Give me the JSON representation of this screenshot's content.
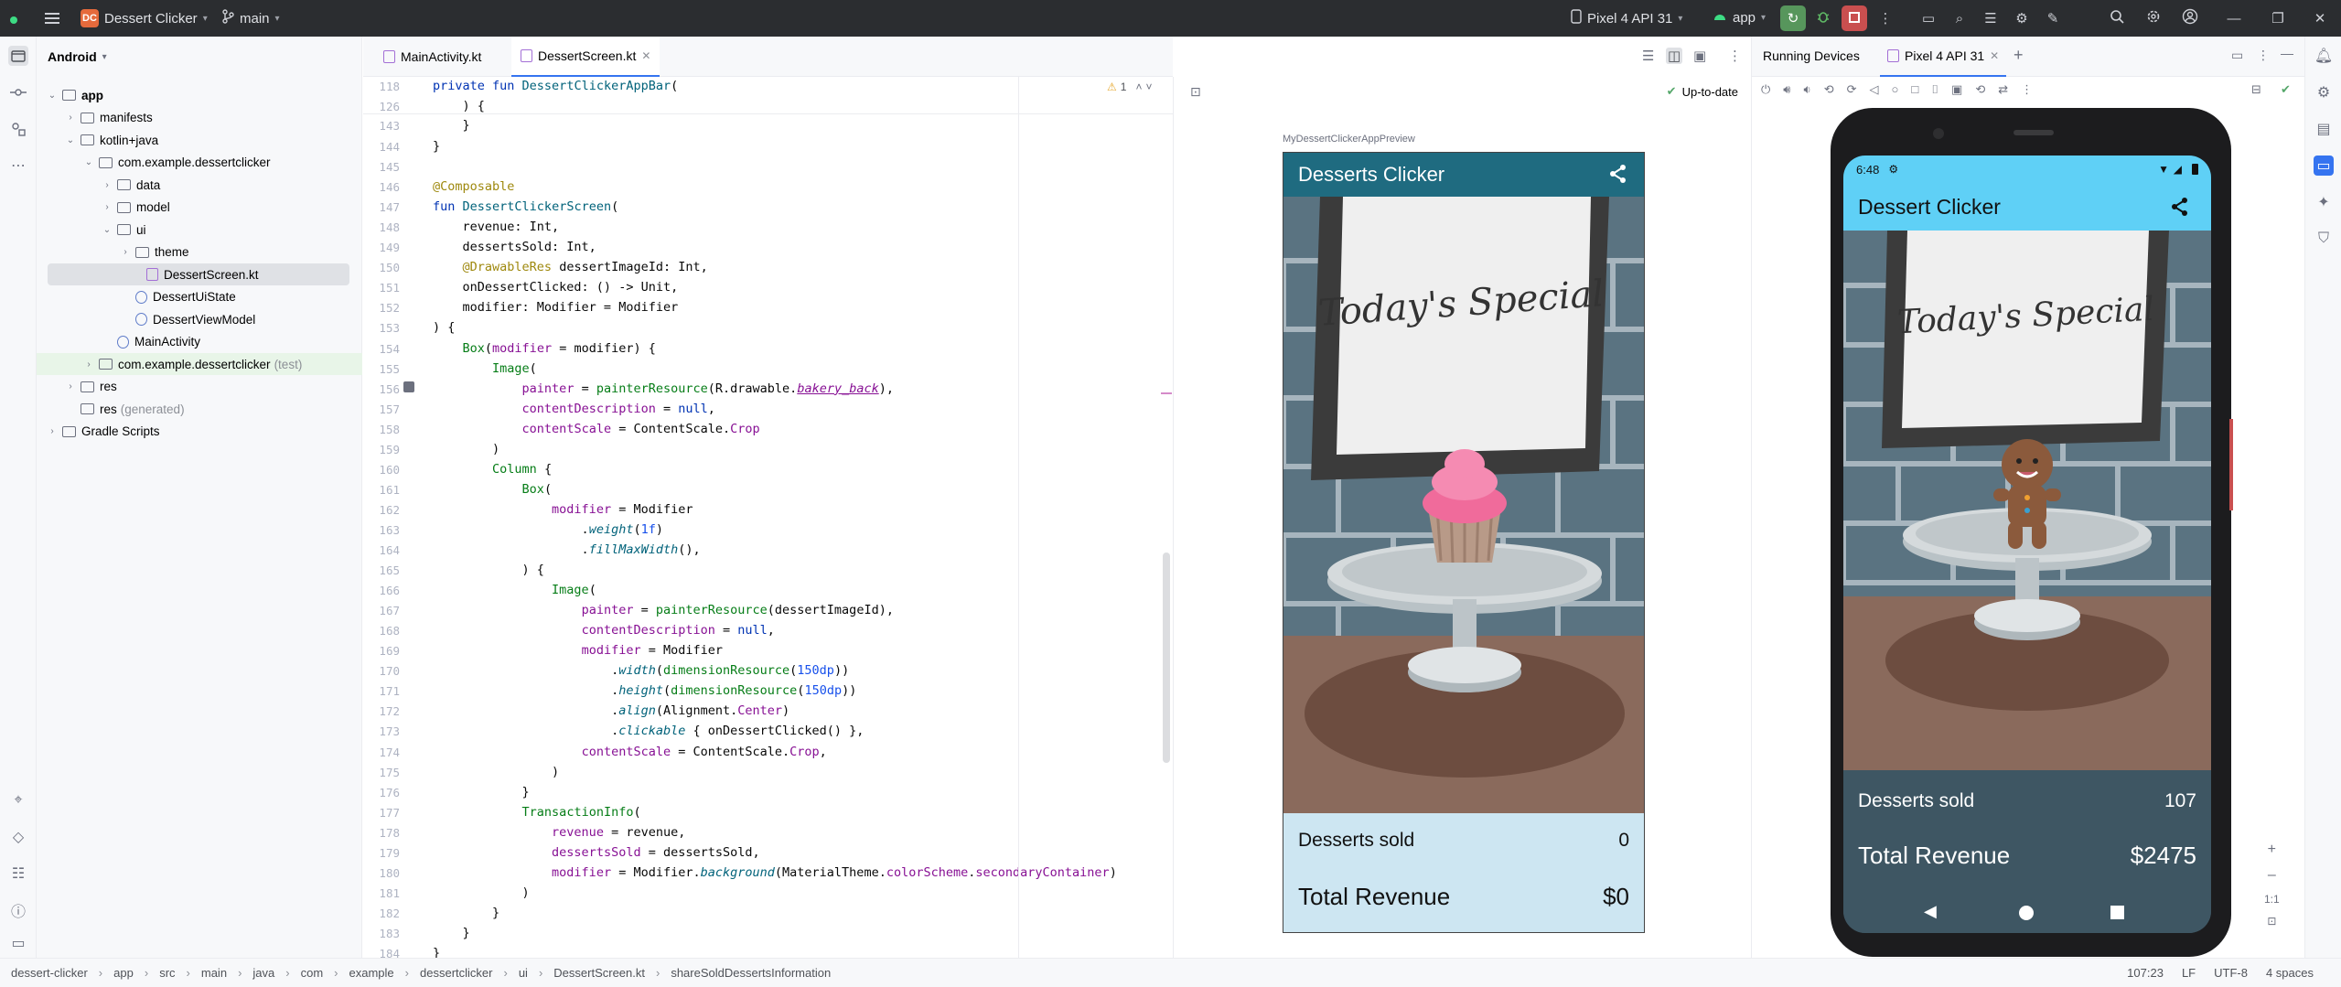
{
  "titlebar": {
    "project_badge": "DC",
    "project_name": "Dessert Clicker",
    "branch": "main",
    "device": "Pixel 4 API 31",
    "run_config": "app"
  },
  "project_panel": {
    "view": "Android",
    "items": [
      {
        "label": "app",
        "indent": 0,
        "icon": "folder",
        "chev": "down"
      },
      {
        "label": "manifests",
        "indent": 1,
        "icon": "folder",
        "chev": "right"
      },
      {
        "label": "kotlin+java",
        "indent": 1,
        "icon": "folder",
        "chev": "down"
      },
      {
        "label": "com.example.dessertclicker",
        "indent": 2,
        "icon": "folder",
        "chev": "down"
      },
      {
        "label": "data",
        "indent": 3,
        "icon": "folder",
        "chev": "right"
      },
      {
        "label": "model",
        "indent": 3,
        "icon": "folder",
        "chev": "right"
      },
      {
        "label": "ui",
        "indent": 3,
        "icon": "folder",
        "chev": "down"
      },
      {
        "label": "theme",
        "indent": 4,
        "icon": "folder",
        "chev": "right"
      },
      {
        "label": "DessertScreen.kt",
        "indent": 4,
        "icon": "kt",
        "chev": ""
      },
      {
        "label": "DessertUiState",
        "indent": 4,
        "icon": "file",
        "chev": ""
      },
      {
        "label": "DessertViewModel",
        "indent": 4,
        "icon": "file",
        "chev": ""
      },
      {
        "label": "MainActivity",
        "indent": 3,
        "icon": "file",
        "chev": ""
      },
      {
        "label": "com.example.dessertclicker",
        "suffix": "(test)",
        "indent": 2,
        "icon": "folder",
        "chev": "right"
      },
      {
        "label": "res",
        "indent": 1,
        "icon": "folder",
        "chev": "right"
      },
      {
        "label": "res",
        "suffix": "(generated)",
        "indent": 1,
        "icon": "folder",
        "chev": ""
      },
      {
        "label": "Gradle Scripts",
        "indent": 0,
        "icon": "gradle",
        "chev": "right"
      }
    ]
  },
  "editor": {
    "tabs": [
      "MainActivity.kt",
      "DessertScreen.kt"
    ],
    "active_tab": "DessertScreen.kt",
    "warnings": "1",
    "line_numbers": [
      "118",
      "126",
      "143",
      "144",
      "145",
      "146",
      "147",
      "148",
      "149",
      "150",
      "151",
      "152",
      "153",
      "154",
      "155",
      "156",
      "157",
      "158",
      "159",
      "160",
      "161",
      "162",
      "163",
      "164",
      "165",
      "166",
      "167",
      "168",
      "169",
      "170",
      "171",
      "172",
      "173",
      "174",
      "175",
      "176",
      "177",
      "178",
      "179",
      "180",
      "181",
      "182",
      "183",
      "184"
    ]
  },
  "preview": {
    "status": "Up-to-date",
    "name": "MyDessertClickerAppPreview",
    "app_title": "Desserts Clicker",
    "sign_text": "Today's Special",
    "desserts_sold_label": "Desserts sold",
    "desserts_sold_value": "0",
    "revenue_label": "Total Revenue",
    "revenue_value": "$0"
  },
  "running_devices": {
    "title": "Running Devices",
    "device_tab": "Pixel 4 API 31",
    "time": "6:48",
    "app_title": "Dessert Clicker",
    "sign_text": "Today's Special",
    "desserts_sold_label": "Desserts sold",
    "desserts_sold_value": "107",
    "revenue_label": "Total Revenue",
    "revenue_value": "$2475",
    "zoom": "1:1"
  },
  "statusbar": {
    "breadcrumbs": [
      "dessert-clicker",
      "app",
      "src",
      "main",
      "java",
      "com",
      "example",
      "dessertclicker",
      "ui",
      "DessertScreen.kt",
      "shareSoldDessertsInformation"
    ],
    "position": "107:23",
    "line_sep": "LF",
    "encoding": "UTF-8",
    "indent": "4 spaces"
  },
  "colors": {
    "accent": "#3574f0",
    "appbar_preview": "#1f6b80",
    "appbar_device": "#5fd0f6",
    "info_bg_preview": "#cde6f2",
    "info_bg_device": "#3e5663"
  }
}
